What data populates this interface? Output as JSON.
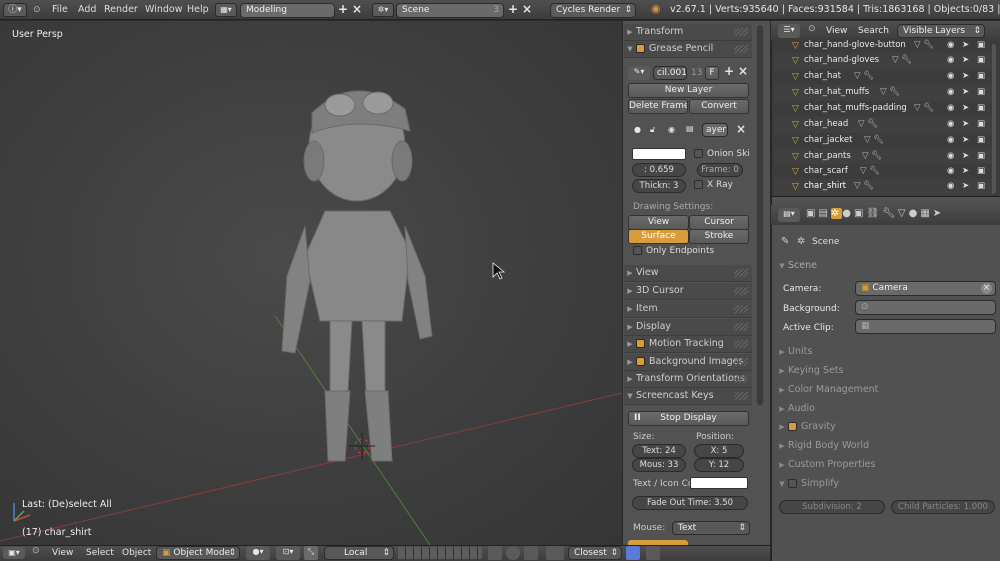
{
  "topbar": {
    "menus": [
      "File",
      "Add",
      "Render",
      "Window",
      "Help"
    ],
    "layout": "Modeling",
    "scene": "Scene",
    "scene_num": "3",
    "engine": "Cycles Render",
    "stats": "v2.67.1 | Verts:935640 | Faces:931584 | Tris:1863168 | Objects:0/83 | Lamps:0/4"
  },
  "viewport": {
    "view_name": "User Persp",
    "last_op": "Last: (De)select All",
    "active_obj": "(17) char_shirt"
  },
  "bottombar": {
    "menus": [
      "View",
      "Select",
      "Object"
    ],
    "mode": "Object Mode",
    "pivot": "Local",
    "snap": "Closest"
  },
  "npanel": {
    "transform": "Transform",
    "grease_pencil": "Grease Pencil",
    "gp_name": "cil.001",
    "gp_users": "13",
    "gp_fake": "F",
    "new_layer": "New Layer",
    "delete_frame": "Delete Frame",
    "convert": "Convert",
    "layer_name": "ayer",
    "onion": "Onion Ski",
    "opacity": ": 0.659",
    "frame": "Frame: 0",
    "thickness": "Thickn: 3",
    "xray": "X Ray",
    "drawing_settings": "Drawing Settings:",
    "view_btn": "View",
    "cursor_btn": "Cursor",
    "surface_btn": "Surface",
    "stroke_btn": "Stroke",
    "only_endpoints": "Only Endpoints",
    "view": "View",
    "cursor3d": "3D Cursor",
    "item": "Item",
    "display": "Display",
    "motion_tracking": "Motion Tracking",
    "background_images": "Background Images",
    "transform_orient": "Transform Orientations",
    "screencast": "Screencast Keys",
    "stop_display": "Stop Display",
    "size_label": "Size:",
    "position_label": "Position:",
    "text_size": "Text: 24",
    "mouse_size": "Mous: 33",
    "pos_x": "X: 5",
    "pos_y": "Y: 12",
    "text_icon_col": "Text / Icon Col",
    "fade_out": "Fade Out Time: 3.50",
    "mouse_label": "Mouse:",
    "mouse_val": "Text"
  },
  "outliner": {
    "view": "View",
    "search": "Search",
    "filter": "Visible Layers",
    "rows": [
      "char_hand-glove-button",
      "char_hand-gloves",
      "char_hat",
      "char_hat_muffs",
      "char_hat_muffs-padding",
      "char_head",
      "char_jacket",
      "char_pants",
      "char_scarf",
      "char_shirt"
    ]
  },
  "properties": {
    "context": "Scene",
    "scene_section": "Scene",
    "camera_label": "Camera:",
    "camera_val": "Camera",
    "background_label": "Background:",
    "active_clip_label": "Active Clip:",
    "sections": [
      "Units",
      "Keying Sets",
      "Color Management",
      "Audio",
      "Gravity",
      "Rigid Body World",
      "Custom Properties",
      "Simplify"
    ],
    "subdivision": "Subdivision: 2",
    "child_particles": "Child Particles: 1.000"
  },
  "colors": {
    "accent": "#d99c3b",
    "viewport_bg": "#3f3f3f",
    "panel_bg": "#525252"
  }
}
